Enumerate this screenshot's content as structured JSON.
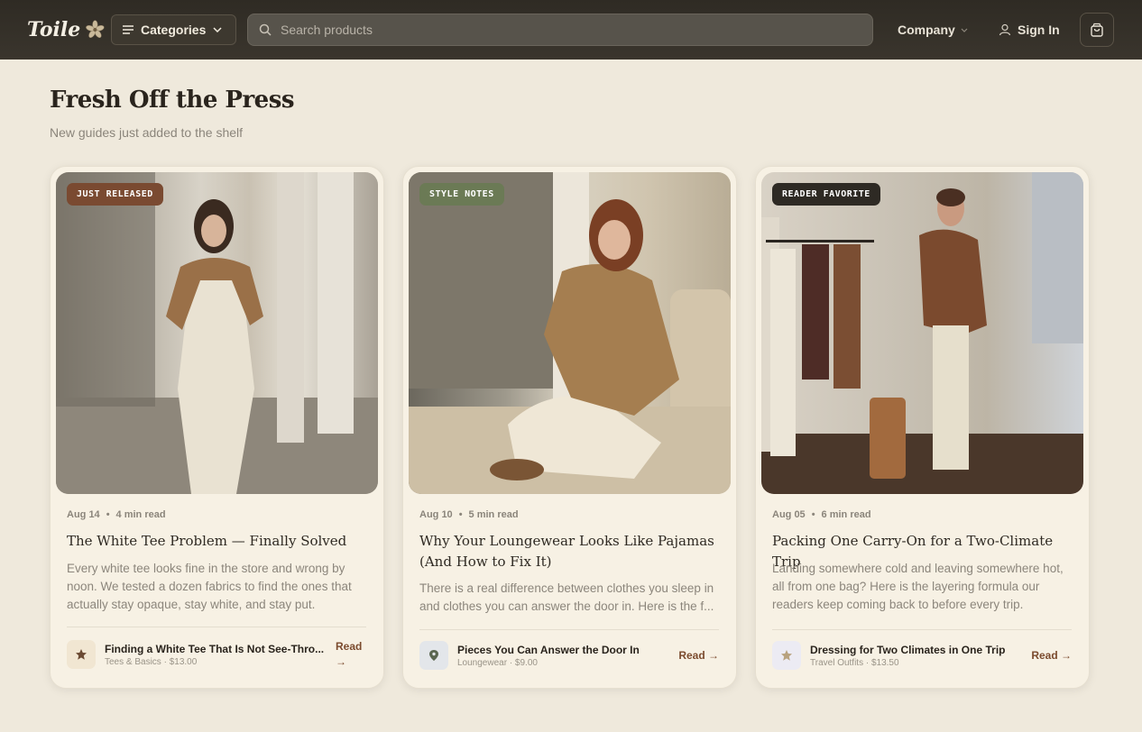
{
  "header": {
    "logo": "Toile",
    "categories_label": "Categories",
    "search_placeholder": "Search products",
    "company_label": "Company",
    "signin_label": "Sign In"
  },
  "section": {
    "title": "Fresh Off the Press",
    "subtitle": "New guides just added to the shelf"
  },
  "cards": [
    {
      "badge": "JUST RELEASED",
      "badge_color": "#7a4a31",
      "date": "Aug 14",
      "read_time": "4 min read",
      "title": "The White Tee Problem — Finally Solved",
      "excerpt": "Every white tee looks fine in the store and wrong by noon. We tested a dozen fabrics to find the ones that actually stay opaque, stay white, and stay put.",
      "product_icon": "star-icon",
      "product_name": "Finding a White Tee That Is Not See-Thro...",
      "product_meta": "Tees & Basics · $13.00",
      "read_label": "Read →"
    },
    {
      "badge": "STYLE NOTES",
      "badge_color": "#6b7a55",
      "date": "Aug 10",
      "read_time": "5 min read",
      "title": "Why Your Loungewear Looks Like Pajamas (And How to Fix It)",
      "excerpt": "There is a real difference between clothes you sleep in and clothes you can answer the door in. Here is the f...",
      "product_icon": "location-pin-icon",
      "product_name": "Pieces You Can Answer the Door In",
      "product_meta": "Loungewear · $9.00",
      "read_label": "Read →"
    },
    {
      "badge": "READER FAVORITE",
      "badge_color": "#2e2a24",
      "date": "Aug 05",
      "read_time": "6 min read",
      "title": "Packing One Carry-On for a Two-Climate Trip",
      "excerpt": "Landing somewhere cold and leaving somewhere hot, all from one bag? Here is the layering formula our readers keep coming back to before every trip.",
      "product_icon": "star-icon",
      "product_name": "Dressing for Two Climates in One Trip",
      "product_meta": "Travel Outfits · $13.50",
      "read_label": "Read →"
    }
  ]
}
